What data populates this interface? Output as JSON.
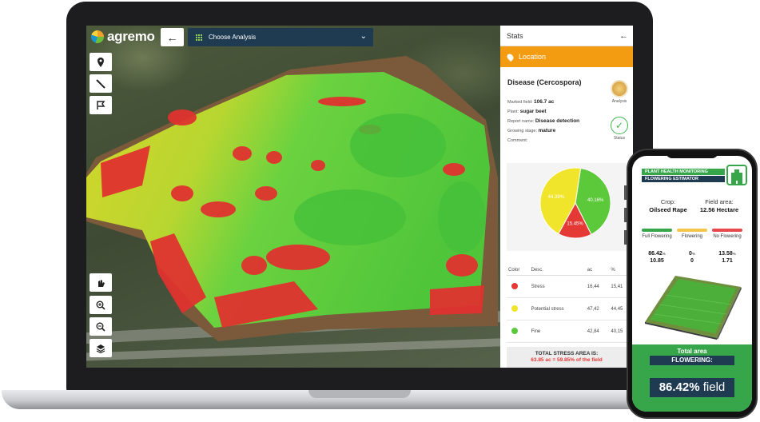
{
  "app": {
    "brand": "agremo",
    "back_icon": "arrow-left-icon",
    "analysis_select": "Choose Analysis",
    "tools": [
      "location-pin-icon",
      "ruler-icon",
      "polygon-flag-icon",
      "hand-pin-icon",
      "zoom-in-icon",
      "zoom-out-icon",
      "layers-icon"
    ]
  },
  "stats_panel": {
    "title": "Stats",
    "location_label": "Location",
    "disease_title": "Disease (Cercospora)",
    "fields": [
      {
        "label": "Marked field:",
        "value": "106.7 ac"
      },
      {
        "label": "Plant:",
        "value": "sugar beet"
      },
      {
        "label": "Report name:",
        "value": "Disease detection"
      },
      {
        "label": "Growing stage:",
        "value": "mature"
      },
      {
        "label": "Comment:",
        "value": ""
      }
    ],
    "analysis_label": "Analysis",
    "status_label": "Status",
    "pie_labels": [
      "40.16%",
      "15.45%",
      "44.39%"
    ],
    "table": {
      "headers": [
        "Color",
        "Desc.",
        "ac",
        "%"
      ],
      "rows": [
        {
          "color": "#e53935",
          "desc": "Stress",
          "ac": "16,44",
          "pct": "15,41"
        },
        {
          "color": "#f1e52b",
          "desc": "Potential stress",
          "ac": "47,42",
          "pct": "44,45"
        },
        {
          "color": "#5cc93b",
          "desc": "Fine",
          "ac": "42,84",
          "pct": "40,15"
        }
      ]
    },
    "total_title": "TOTAL STRESS AREA IS:",
    "total_value": "63.85 ac = 59.85% of the field"
  },
  "chart_data": {
    "type": "pie",
    "slices": [
      {
        "label": "40.16%",
        "value": 40.16,
        "color": "#5cc93b"
      },
      {
        "label": "15.45%",
        "value": 15.45,
        "color": "#e53935"
      },
      {
        "label": "44.39%",
        "value": 44.39,
        "color": "#f1e52b"
      }
    ]
  },
  "phone": {
    "banner_1": "PLANT HEALTH MONITORING",
    "banner_2": "FLOWERING ESTIMATOR",
    "crop_label": "Crop:",
    "crop_value": "Oilseed Rape",
    "area_label": "Field area:",
    "area_value": "12.56 Hectare",
    "categories": [
      {
        "name": "Full Flowering",
        "color": "#37a64a",
        "pct": "86.42",
        "pct_unit": "%",
        "ha": "10.85"
      },
      {
        "name": "Flowering",
        "color": "#f3c64a",
        "pct": "0",
        "pct_unit": "%",
        "ha": "0"
      },
      {
        "name": "No Flowering",
        "color": "#e5484d",
        "pct": "13.58",
        "pct_unit": "%",
        "ha": "1.71"
      }
    ],
    "total_line_1": "Total area",
    "total_line_2": "FLOWERING:",
    "result_pct": "86.42%",
    "result_unit": "field"
  },
  "colors": {
    "stress": "#e53935",
    "potential": "#f1e52b",
    "fine": "#5cc93b",
    "location_bar": "#f39c12",
    "navy": "#1f3b52"
  }
}
